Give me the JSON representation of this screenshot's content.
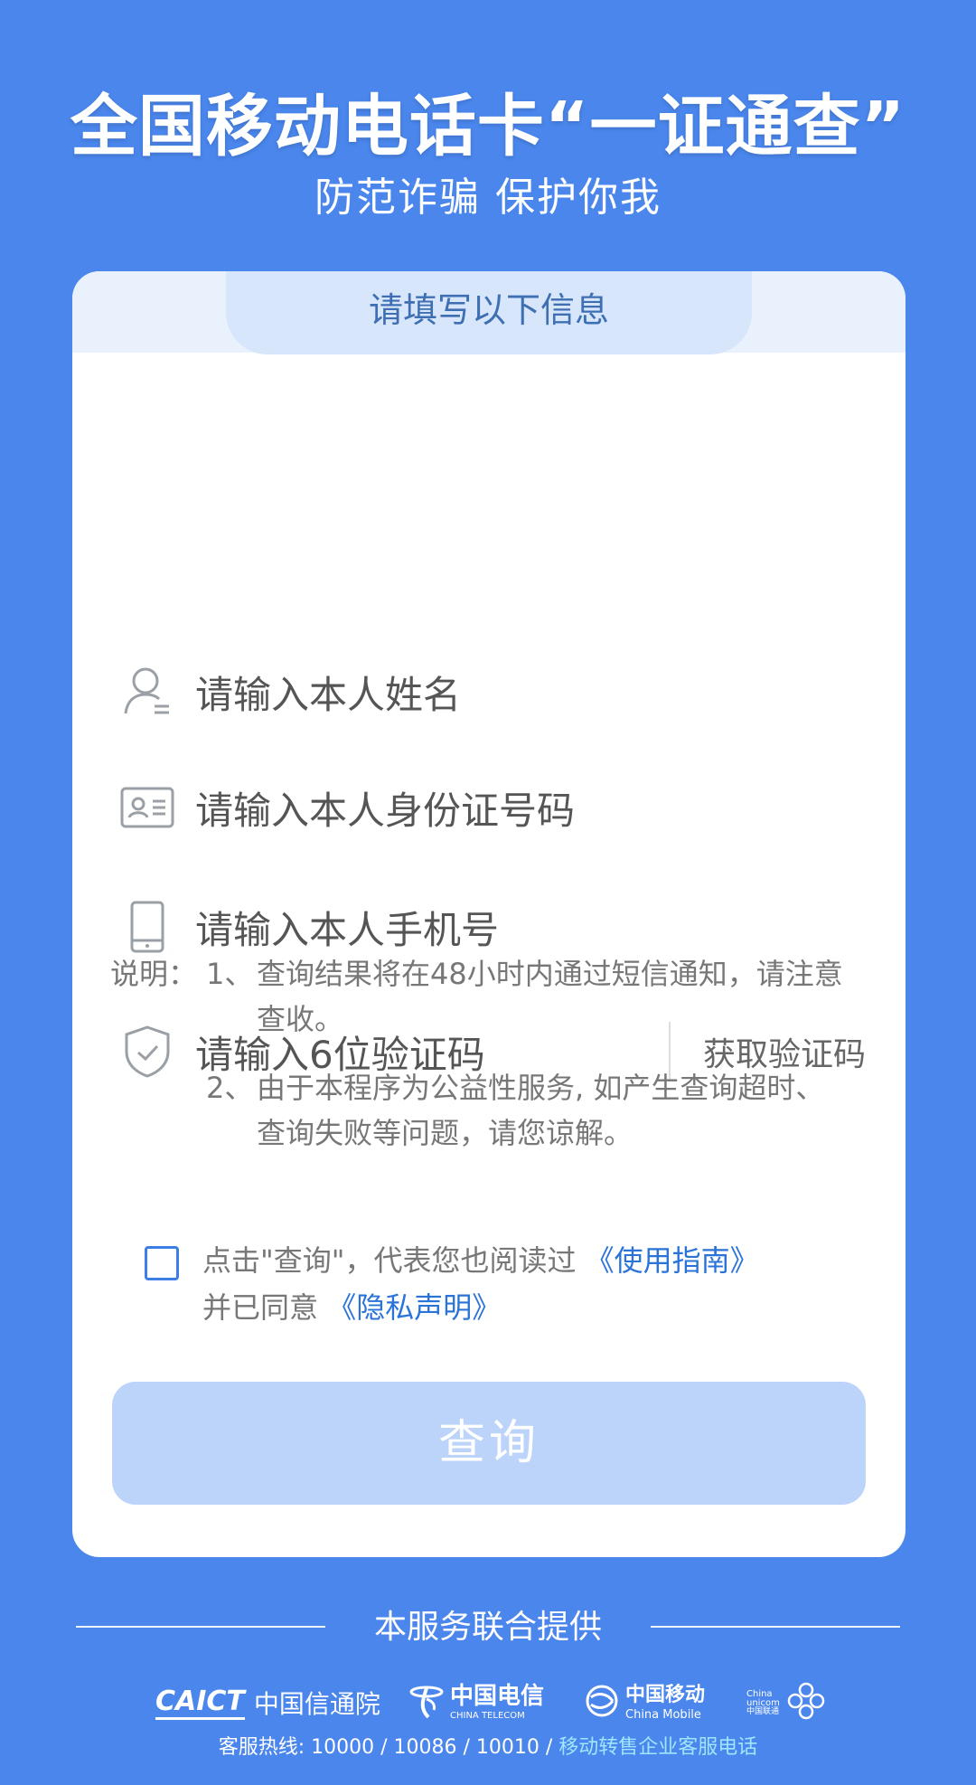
{
  "header": {
    "title": "全国移动电话卡“一证通查”",
    "subtitle": "防范诈骗 保护你我"
  },
  "form": {
    "heading": "请填写以下信息",
    "name_placeholder": "请输入本人姓名",
    "id_placeholder": "请输入本人身份证号码",
    "phone_placeholder": "请输入本人手机号",
    "code_placeholder": "请输入6位验证码",
    "get_code_label": "获取验证码"
  },
  "notes": {
    "label": "说明：",
    "items": [
      {
        "num": "1、",
        "text": "查询结果将在48小时内通过短信通知，请注意查收。"
      },
      {
        "num": "2、",
        "text": "由于本程序为公益性服务, 如产生查询超时、查询失败等问题，请您谅解。"
      }
    ]
  },
  "agreement": {
    "prefix": "点击\"查询\"，代表您也阅读过 ",
    "guide_link": "《使用指南》",
    "middle": "并已同意 ",
    "privacy_link": "《隐私声明》",
    "checked": false
  },
  "query_button": "查询",
  "footer": {
    "title": "本服务联合提供",
    "logos": {
      "caict_en": "CAICT",
      "caict_cn": "中国信通院",
      "telecom_cn": "中国电信",
      "telecom_en": "CHINA TELECOM",
      "mobile_cn": "中国移动",
      "mobile_en": "China Mobile",
      "unicom_en": "China unicom",
      "unicom_cn": "中国联通"
    },
    "hotline_prefix": "客服热线: 10000 / 10086 / 10010 / ",
    "hotline_link": "移动转售企业客服电话"
  },
  "colors": {
    "background": "#4a86ec",
    "accent": "#2a73d9",
    "button_disabled": "#bcd3fa"
  }
}
